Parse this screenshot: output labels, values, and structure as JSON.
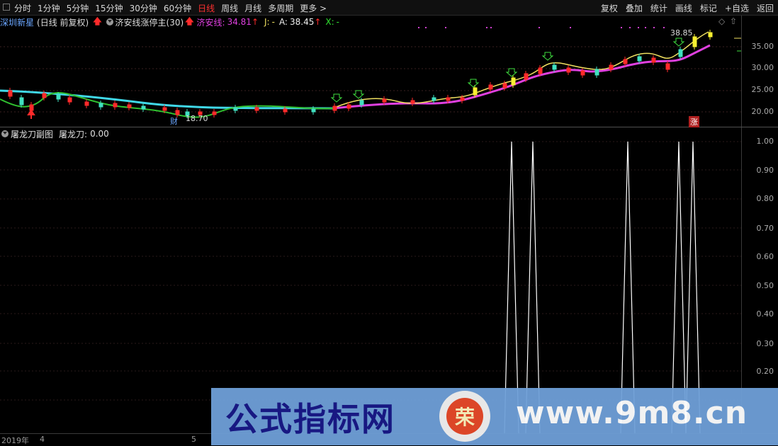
{
  "toolbar": {
    "periods": [
      "分时",
      "1分钟",
      "5分钟",
      "15分钟",
      "30分钟",
      "60分钟",
      "日线",
      "周线",
      "月线",
      "多周期",
      "更多 >"
    ],
    "active_index": 6,
    "right": [
      "复权",
      "叠加",
      "统计",
      "画线",
      "标记",
      "+自选",
      "返回"
    ]
  },
  "main_panel": {
    "stock_name": "深圳新星",
    "period_info": "(日线 前复权)",
    "indicator_name": "济安线涨停主(30)",
    "jian_label": "济安线:",
    "jian_value": "34.81",
    "j_label": "J:",
    "j_value": "-",
    "a_label": "A:",
    "a_value": "38.45",
    "x_label": "X:",
    "x_value": "-",
    "y_ticks": [
      "35.00",
      "30.00",
      "25.00",
      "20.00"
    ],
    "high_label": "38.85",
    "low_label": "18.70",
    "cai_marker": "财",
    "zhang_marker": "涨"
  },
  "sub_panel": {
    "title": "屠龙刀副图",
    "value_label": "屠龙刀:",
    "value": "0.00",
    "y_ticks": [
      "1.00",
      "0.90",
      "0.80",
      "0.70",
      "0.60",
      "0.50",
      "0.40",
      "0.30",
      "0.20"
    ]
  },
  "x_axis": {
    "labels": [
      "2019年",
      "4",
      "5"
    ]
  },
  "watermark": {
    "left_text": "公式指标网",
    "logo_text": "荣",
    "right_text": "www.9m8.cn"
  },
  "colors": {
    "jian": "#e040e0",
    "cyan": "#40d8e8",
    "green": "#30c030",
    "yellow": "#f0e060",
    "up": "#ff2a2a",
    "down": "#40e0c0"
  }
}
